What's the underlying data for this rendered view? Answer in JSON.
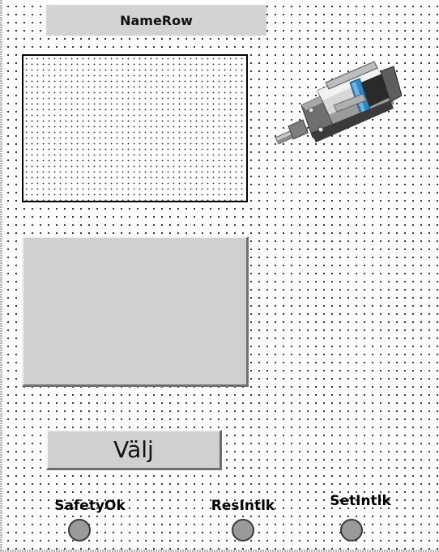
{
  "name_row": {
    "label": "NameRow"
  },
  "button": {
    "label": "Välj"
  },
  "indicators": [
    {
      "label": "SafetyOk",
      "state": "off",
      "color": "#9a9a9a"
    },
    {
      "label": "ResIntlk",
      "state": "off",
      "color": "#9a9a9a"
    },
    {
      "label": "SetIntlk",
      "state": "off",
      "color": "#9a9a9a"
    }
  ],
  "colors": {
    "panel_gray": "#d0d0d0",
    "name_row_bg": "#d3d3d3",
    "lamp_off": "#9a9a9a",
    "cylinder_accent": "#2f86c5"
  },
  "icons": {
    "device": "pneumatic-cylinder-icon"
  }
}
